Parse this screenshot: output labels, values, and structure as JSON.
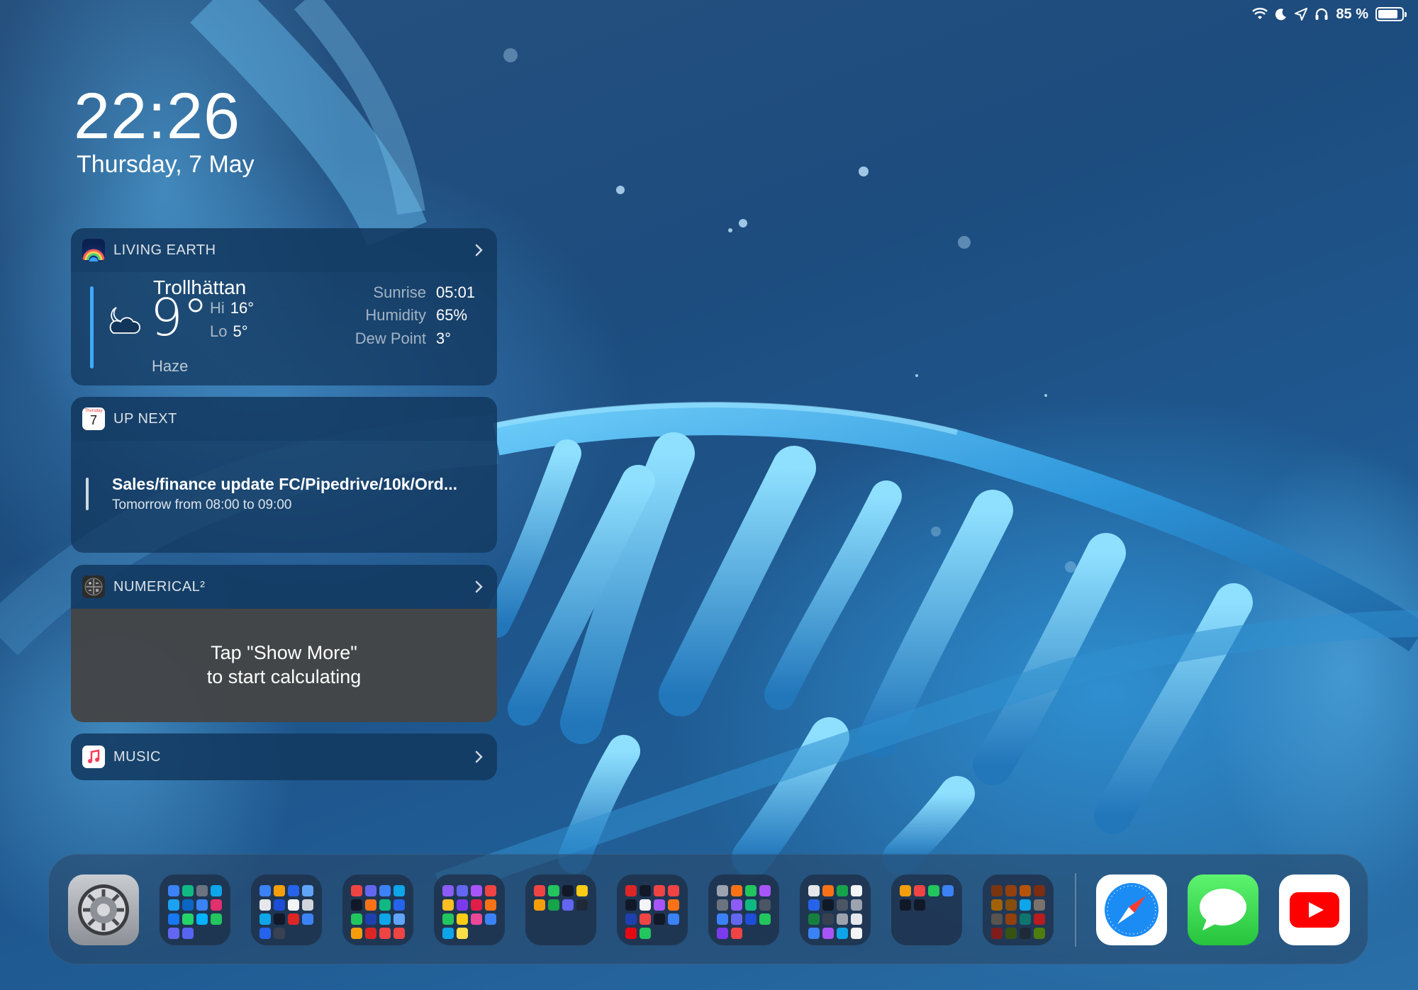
{
  "status_bar": {
    "icons": [
      "wifi-icon",
      "moon-icon",
      "location-icon",
      "headphones-icon"
    ],
    "battery_text": "85 %",
    "battery_level": 0.85
  },
  "lock": {
    "time": "22:26",
    "date": "Thursday, 7 May"
  },
  "widgets": {
    "weather": {
      "title": "LIVING EARTH",
      "city": "Trollhättan",
      "temperature": "9°",
      "hi_label": "Hi",
      "hi_value": "16°",
      "lo_label": "Lo",
      "lo_value": "5°",
      "condition": "Haze",
      "sunrise_label": "Sunrise",
      "sunrise_value": "05:01",
      "humidity_label": "Humidity",
      "humidity_value": "65%",
      "dewpoint_label": "Dew Point",
      "dewpoint_value": "3°",
      "icon": "partly-cloudy-night-icon"
    },
    "up_next": {
      "title": "UP NEXT",
      "calendar_day": "7",
      "calendar_weekday": "Thursday",
      "event_title": "Sales/finance update FC/Pipedrive/10k/Ord...",
      "event_time": "Tomorrow from 08:00 to 09:00"
    },
    "numerical": {
      "title": "NUMERICAL²",
      "line1": "Tap \"Show More\"",
      "line2": "to start calculating"
    },
    "music": {
      "title": "MUSIC"
    }
  },
  "dock": {
    "apps": [
      "Settings",
      "Safari",
      "Messages",
      "YouTube"
    ],
    "folders": [
      {
        "name": "folder-1",
        "colors": [
          "#3b82f6",
          "#10b981",
          "#6b7280",
          "#0ea5e9",
          "#1da1f2",
          "#0a66c2",
          "#3b82f6",
          "#e1306c",
          "#1877f2",
          "#25d366",
          "#00b2ff",
          "#22c55e",
          "#6366f1",
          "#5865f2"
        ]
      },
      {
        "name": "folder-2",
        "colors": [
          "#3b82f6",
          "#f59e0b",
          "#2563eb",
          "#60a5fa",
          "#e5e7eb",
          "#1d4ed8",
          "#f3f4f6",
          "#d1d5db",
          "#0ea5e9",
          "#111827",
          "#dc2626",
          "#3b82f6",
          "#2563eb",
          "#374151"
        ]
      },
      {
        "name": "folder-3",
        "colors": [
          "#ef4444",
          "#6366f1",
          "#3b82f6",
          "#0ea5e9",
          "#111827",
          "#f97316",
          "#10b981",
          "#2563eb",
          "#22c55e",
          "#1e40af",
          "#0ea5e9",
          "#60a5fa",
          "#f59e0b",
          "#dc2626",
          "#ef4444",
          "#ef4444"
        ]
      },
      {
        "name": "folder-4",
        "colors": [
          "#8b5cf6",
          "#6366f1",
          "#a855f7",
          "#ef4444",
          "#fbbf24",
          "#7c3aed",
          "#e11d48",
          "#f97316",
          "#22c55e",
          "#facc15",
          "#ec4899",
          "#3b82f6",
          "#0ea5e9",
          "#fde047"
        ]
      },
      {
        "name": "folder-5",
        "colors": [
          "#ef4444",
          "#22c55e",
          "#111827",
          "#facc15",
          "#f59e0b",
          "#16a34a",
          "#6366f1",
          "#1f2937"
        ]
      },
      {
        "name": "folder-6",
        "colors": [
          "#dc2626",
          "#111827",
          "#ef4444",
          "#ef4444",
          "#111827",
          "#f3f4f6",
          "#a855f7",
          "#f97316",
          "#1e40af",
          "#ef4444",
          "#111827",
          "#3b82f6",
          "#e50914",
          "#22c55e"
        ]
      },
      {
        "name": "folder-7",
        "colors": [
          "#9ca3af",
          "#f97316",
          "#22c55e",
          "#a855f7",
          "#6b7280",
          "#8b5cf6",
          "#10b981",
          "#4b5563",
          "#3b82f6",
          "#6366f1",
          "#1d4ed8",
          "#22c55e",
          "#7c3aed",
          "#ef4444"
        ]
      },
      {
        "name": "folder-8",
        "colors": [
          "#e5e7eb",
          "#f97316",
          "#16a34a",
          "#f3f4f6",
          "#2563eb",
          "#111827",
          "#4b5563",
          "#9ca3af",
          "#15803d",
          "#374151",
          "#9ca3af",
          "#e5e7eb",
          "#3b82f6",
          "#a855f7",
          "#0ea5e9",
          "#f3f4f6"
        ]
      },
      {
        "name": "folder-9",
        "colors": [
          "#f59e0b",
          "#ef4444",
          "#22c55e",
          "#3b82f6",
          "#111827",
          "#111827"
        ]
      },
      {
        "name": "folder-10",
        "colors": [
          "#78350f",
          "#92400e",
          "#b45309",
          "#7c2d12",
          "#a16207",
          "#854d0e",
          "#0ea5e9",
          "#78716c",
          "#57534e",
          "#92400e",
          "#0f766e",
          "#b91c1c",
          "#7f1d1d",
          "#365314",
          "#1f2937",
          "#4d7c0f"
        ]
      }
    ]
  }
}
